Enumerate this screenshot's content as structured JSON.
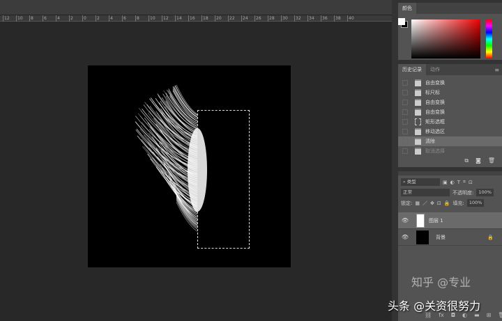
{
  "ruler": {
    "ticks": [
      "12",
      "10",
      "8",
      "6",
      "4",
      "2",
      "0",
      "2",
      "4",
      "6",
      "8",
      "10",
      "12",
      "14",
      "16",
      "18",
      "20",
      "22",
      "24",
      "26",
      "28",
      "30",
      "32",
      "34",
      "36",
      "38",
      "40"
    ]
  },
  "color_panel": {
    "title": "颜色",
    "fg": "#ffffff",
    "bg": "#000000"
  },
  "history_panel": {
    "tabs": [
      "历史记录",
      "动作"
    ],
    "items": [
      "自由变换",
      "标尺标",
      "自由变换",
      "自由变换",
      "矩形选框",
      "移动选区",
      "清除",
      "取消选择"
    ],
    "current_index": 6
  },
  "layers_panel": {
    "filter": "类型",
    "blend_mode": "正常",
    "opacity_label": "不透明度:",
    "opacity": "100%",
    "lock_label": "锁定:",
    "fill_label": "填充:",
    "fill": "100%",
    "layers": [
      {
        "name": "图层 1",
        "selected": true
      },
      {
        "name": "背景",
        "locked": true
      }
    ]
  },
  "watermark": "头条 @关资很努力",
  "watermark2": "知乎 @专业"
}
